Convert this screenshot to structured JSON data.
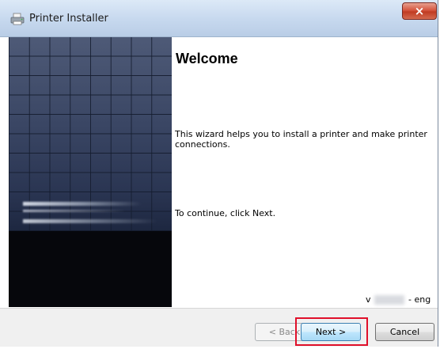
{
  "window": {
    "title": "Printer Installer",
    "close_glyph": "×",
    "title_icon": "printer-icon"
  },
  "content": {
    "heading": "Welcome",
    "intro": "This wizard helps you to install a printer and make printer connections.",
    "continue": "To continue, click Next.",
    "version_prefix": "v",
    "version_suffix": "- eng"
  },
  "buttons": {
    "back": "< Back",
    "next": "Next >",
    "cancel": "Cancel"
  },
  "colors": {
    "highlight": "#e0102a",
    "close": "#c03b22"
  }
}
